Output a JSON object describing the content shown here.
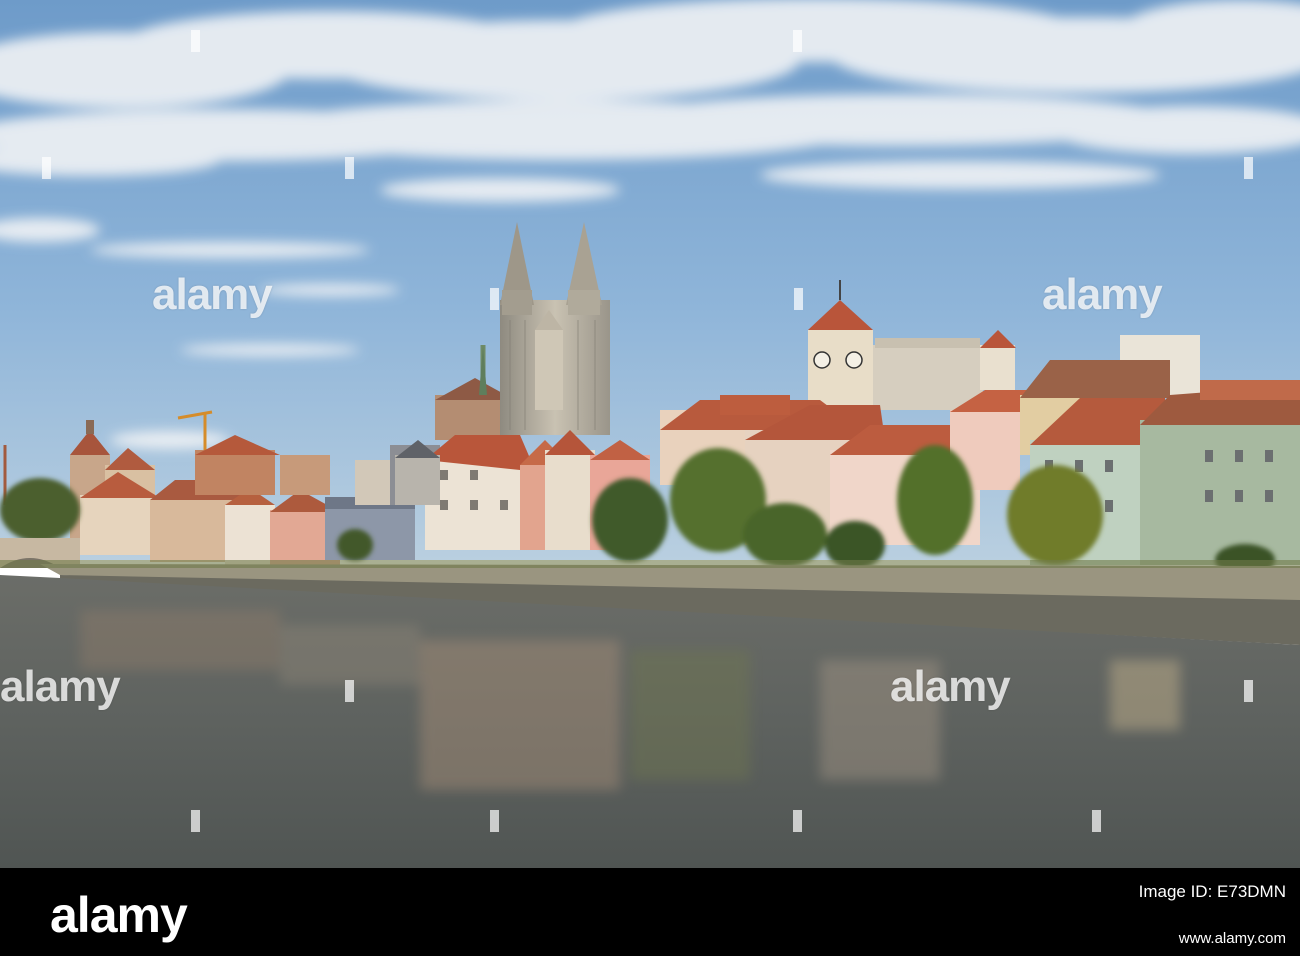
{
  "photo": {
    "subject": "river-city-skyline"
  },
  "watermark": {
    "text": "alamy"
  },
  "banner": {
    "logo": "alamy",
    "image_id": "Image ID: E73DMN",
    "url": "www.alamy.com"
  },
  "colors": {
    "sky_top": "#5d8fc4",
    "sky_bottom": "#a9c6de",
    "water": "#5f6361",
    "roof": "#b9553a",
    "banner": "#000000"
  }
}
